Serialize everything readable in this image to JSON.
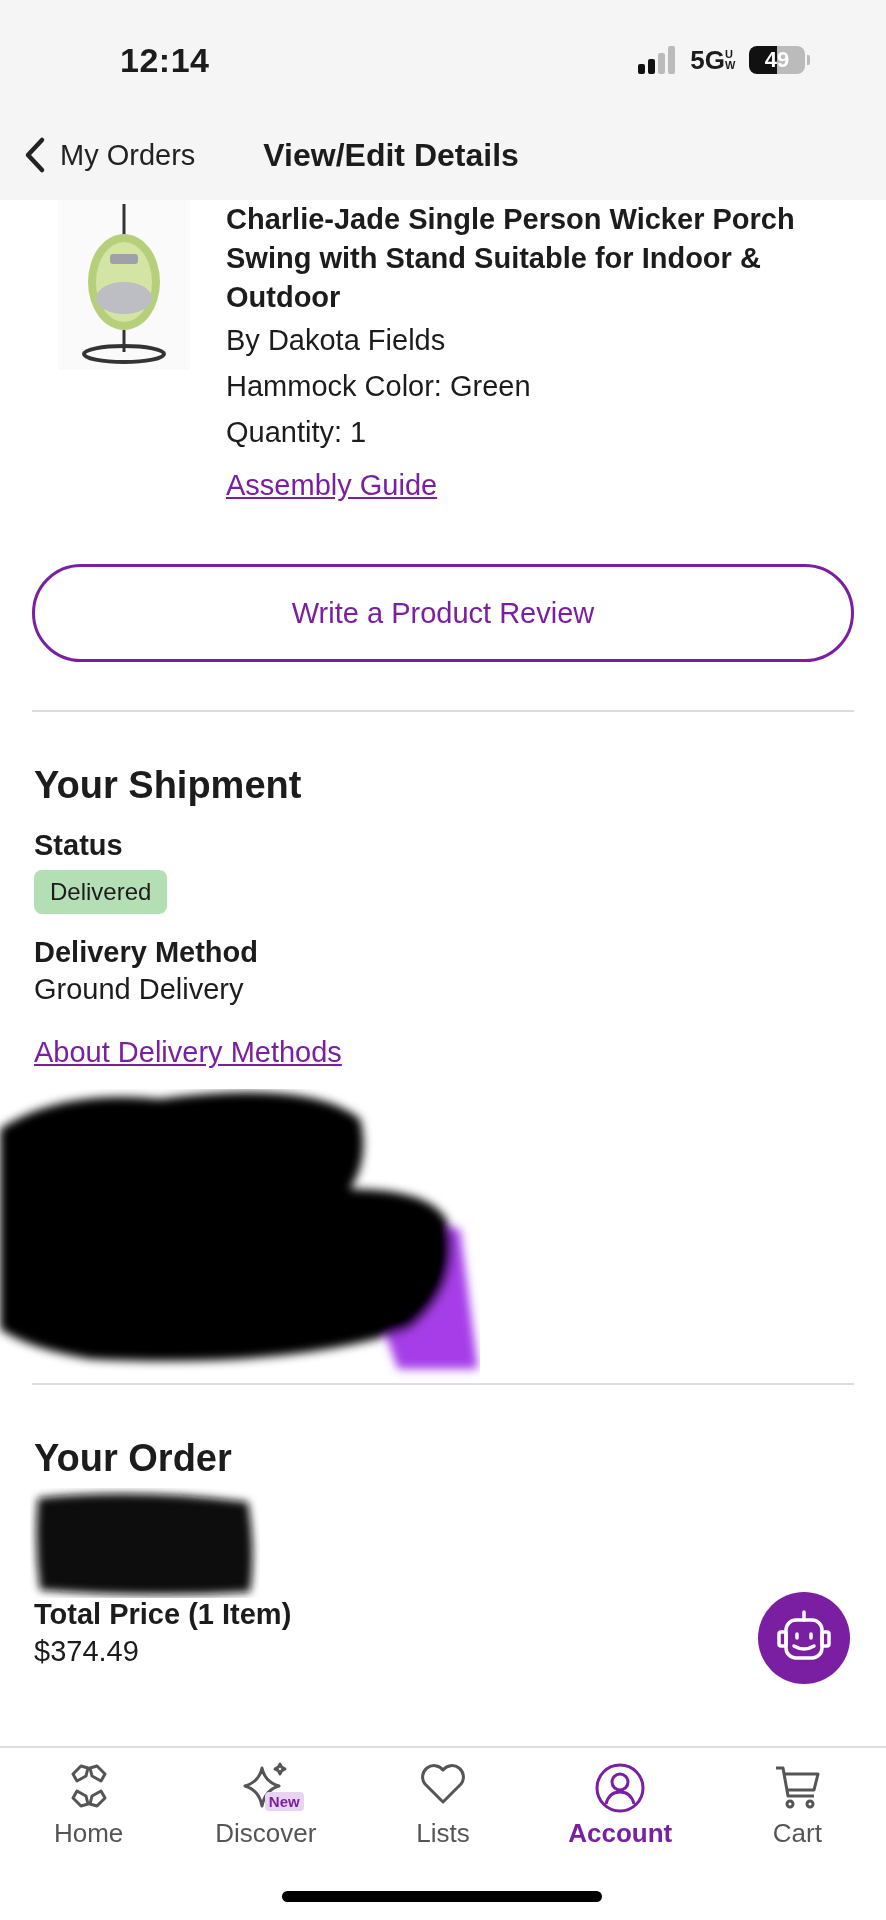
{
  "status_bar": {
    "time": "12:14",
    "network": "5G",
    "network_sub": "UW",
    "battery": "49"
  },
  "header": {
    "back_label": "My Orders",
    "title": "View/Edit Details"
  },
  "product": {
    "kind": "picture",
    "title": "Charlie-Jade Single Person Wicker Porch Swing with Stand Suitable for Indoor & Outdoor",
    "brand": "By Dakota Fields",
    "option": "Hammock Color: Green",
    "quantity": "Quantity: 1",
    "link": "Assembly Guide"
  },
  "review_button": "Write a Product Review",
  "shipment": {
    "heading": "Your Shipment",
    "status_label": "Status",
    "status": "Delivered",
    "method_label": "Delivery Method",
    "method": "Ground Delivery",
    "link": "About Delivery Methods"
  },
  "order": {
    "heading": "Your Order",
    "total_label": "Total Price (1 Item)",
    "total": "$374.49"
  },
  "tab_bar": [
    {
      "kind": "home",
      "label": "Home",
      "selected": false
    },
    {
      "kind": "discover",
      "label": "Discover",
      "badge": "New",
      "selected": false
    },
    {
      "kind": "lists",
      "label": "Lists",
      "selected": false
    },
    {
      "kind": "account",
      "label": "Account",
      "selected": true
    },
    {
      "kind": "cart",
      "label": "Cart",
      "selected": false
    }
  ]
}
